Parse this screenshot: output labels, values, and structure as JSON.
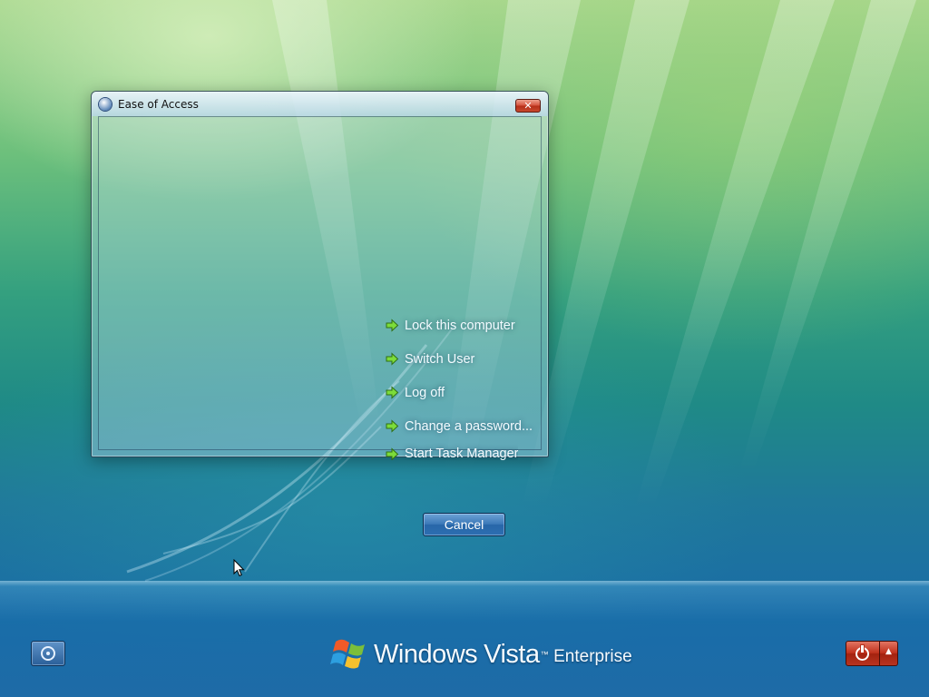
{
  "dialog": {
    "title": "Ease of Access",
    "close_label": "✕"
  },
  "menu": {
    "items": [
      {
        "label": "Lock this computer"
      },
      {
        "label": "Switch User"
      },
      {
        "label": "Log off"
      },
      {
        "label": "Change a password..."
      },
      {
        "label": "Start Task Manager"
      }
    ]
  },
  "cancel_button": {
    "label": "Cancel"
  },
  "branding": {
    "windows": "Windows",
    "vista": "Vista",
    "tm": "™",
    "edition": "Enterprise"
  },
  "icons": {
    "menu_arrow": "green-arrow-icon",
    "ease_of_access": "ease-of-access-icon",
    "power": "power-icon",
    "power_options": "triangle-up-icon",
    "windows_logo": "windows-flag-logo"
  },
  "colors": {
    "power_button": "#c0311c",
    "menu_arrow": "#7cdc3a",
    "cancel_button": "#3b78b8"
  },
  "power_options_glyph": "▲"
}
